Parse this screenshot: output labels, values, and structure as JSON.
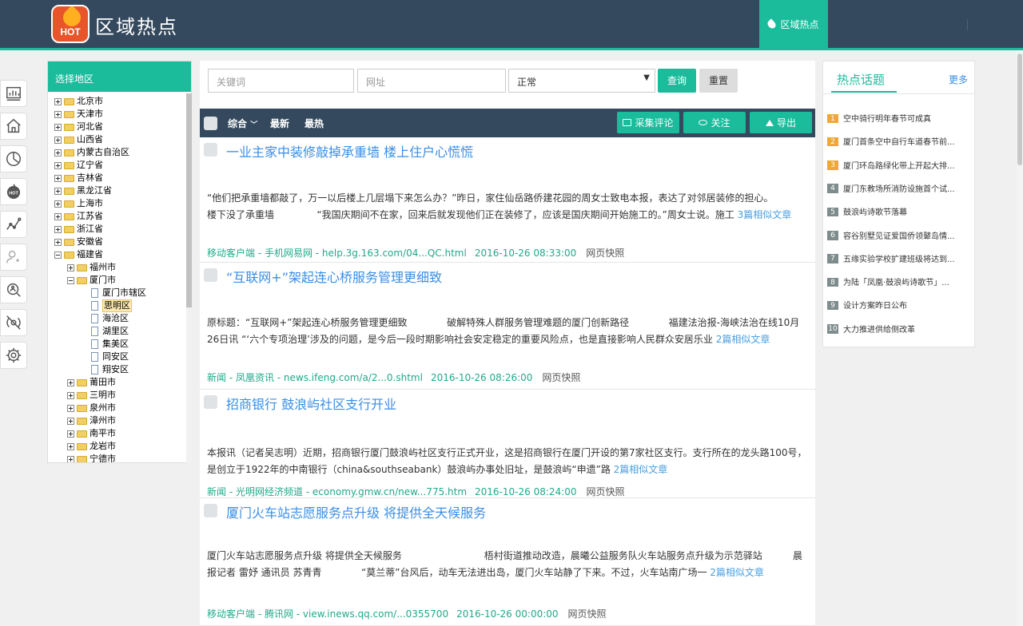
{
  "header": {
    "app_title": "区域热点",
    "logo_text": "HOT",
    "region_button": "区域热点"
  },
  "region_panel": {
    "title": "选择地区",
    "tree": [
      {
        "label": "北京市"
      },
      {
        "label": "天津市"
      },
      {
        "label": "河北省"
      },
      {
        "label": "山西省"
      },
      {
        "label": "内蒙古自治区"
      },
      {
        "label": "辽宁省"
      },
      {
        "label": "吉林省"
      },
      {
        "label": "黑龙江省"
      },
      {
        "label": "上海市"
      },
      {
        "label": "江苏省"
      },
      {
        "label": "浙江省"
      },
      {
        "label": "安徽省"
      },
      {
        "label": "福建省",
        "expanded": true
      },
      {
        "label": "福州市"
      },
      {
        "label": "厦门市",
        "expanded": true
      },
      {
        "label": "厦门市辖区"
      },
      {
        "label": "思明区",
        "selected": true
      },
      {
        "label": "海沧区"
      },
      {
        "label": "湖里区"
      },
      {
        "label": "集美区"
      },
      {
        "label": "同安区"
      },
      {
        "label": "翔安区"
      },
      {
        "label": "莆田市"
      },
      {
        "label": "三明市"
      },
      {
        "label": "泉州市"
      },
      {
        "label": "漳州市"
      },
      {
        "label": "南平市"
      },
      {
        "label": "龙岩市"
      },
      {
        "label": "宁德市"
      }
    ]
  },
  "search": {
    "keyword_placeholder": "关键词",
    "url_placeholder": "网址",
    "status_selected": "正常",
    "query_label": "查询",
    "reset_label": "重置"
  },
  "filter_bar": {
    "tab_all": "综合",
    "tab_latest": "最新",
    "tab_hottest": "最热",
    "collect_label": "采集评论",
    "follow_label": "关注",
    "export_label": "导出"
  },
  "articles": [
    {
      "title": "一业主家中装修敲掉承重墙 楼上住户心慌慌",
      "body": "“他们把承重墙都敲了，万一以后楼上几层塌下来怎么办？”昨日，家住仙岳路侨建花园的周女士致电本报，表达了对邻居装修的担心。             楼下没了承重墙              “我国庆期间不在家，回来后就发现他们正在装修了，应该是国庆期间开始施工的。”周女士说。施工 ",
      "similar": "3篇相似文章",
      "source": "移动客户端 - 手机网易网 - help.3g.163.com/04...QC.html",
      "time": "2016-10-26 08:33:00",
      "snapshot": "网页快照"
    },
    {
      "title": "“互联网+”架起连心桥服务管理更细致",
      "body": "原标题：“互联网+”架起连心桥服务管理更细致             破解特殊人群服务管理难题的厦门创新路径             福建法治报-海峡法治在线10月26日讯 “‘六个专项治理’涉及的问题，是今后一段时期影响社会安定稳定的重要风险点，也是直接影响人民群众安居乐业 ",
      "similar": "2篇相似文章",
      "source": "新闻 - 凤凰资讯 - news.ifeng.com/a/2...0.shtml",
      "time": "2016-10-26 08:26:00",
      "snapshot": "网页快照"
    },
    {
      "title": "招商银行 鼓浪屿社区支行开业",
      "body": "本报讯（记者吴志明）近期，招商银行厦门鼓浪屿社区支行正式开业，这是招商银行在厦门开设的第7家社区支行。支行所在的龙头路100号，是创立于1922年的中南银行（china&southseabank）鼓浪屿办事处旧址，是鼓浪屿“申遗”路 ",
      "similar": "2篇相似文章",
      "source": "新闻 - 光明网经济频道 - economy.gmw.cn/new...775.htm",
      "time": "2016-10-26 08:24:00",
      "snapshot": "网页快照"
    },
    {
      "title": "厦门火车站志愿服务点升级 将提供全天候服务",
      "body": "厦门火车站志愿服务点升级 将提供全天候服务                           梧村街道推动改造，晨曦公益服务队火车站服务点升级为示范驿站          晨报记者 雷妤 通讯员 苏青青             “莫兰蒂”台风后，动车无法进出岛，厦门火车站静了下来。不过，火车站南广场一 ",
      "similar": "2篇相似文章",
      "source": "移动客户端 - 腾讯网 - view.inews.qq.com/...0355700",
      "time": "2016-10-26 00:00:00",
      "snapshot": "网页快照"
    }
  ],
  "hot_topics": {
    "title": "热点话题",
    "more": "更多",
    "items": [
      {
        "num": "1",
        "text": "空中骑行明年春节可成真"
      },
      {
        "num": "2",
        "text": "厦门首条空中自行车道春节前..."
      },
      {
        "num": "3",
        "text": "厦门环岛路绿化带上开起大排..."
      },
      {
        "num": "4",
        "text": "厦门东教场所消防设施首个试..."
      },
      {
        "num": "5",
        "text": "鼓浪屿诗歌节落幕"
      },
      {
        "num": "6",
        "text": "容谷别墅见证爱国侨领鼙岛情..."
      },
      {
        "num": "7",
        "text": "五缘实验学校扩建班级将达到..."
      },
      {
        "num": "8",
        "text": "为陆「凤凰·鼓浪屿诗歌节」..."
      },
      {
        "num": "9",
        "text": "设计方案昨日公布"
      },
      {
        "num": "10",
        "text": "大力推进供给侧改革"
      }
    ]
  },
  "colors": {
    "header": "#34495e",
    "accent": "#1abc9c",
    "link": "#3a8ee6",
    "rank_hi": "#f0a73a",
    "rank_lo": "#7f8c8d"
  }
}
